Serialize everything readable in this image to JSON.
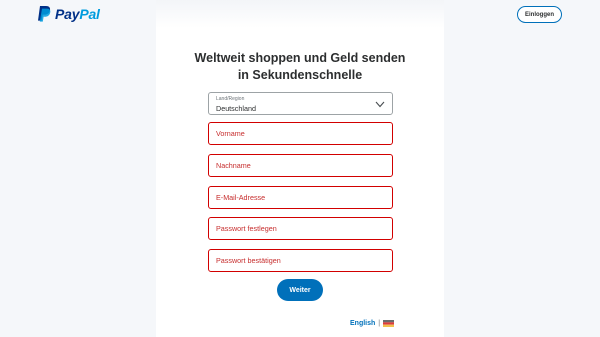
{
  "brand": {
    "logo_pay": "Pay",
    "logo_pal": "Pal",
    "logo_icon": "paypal-p-icon",
    "primary_color": "#003087",
    "secondary_color": "#009cde"
  },
  "header": {
    "login_label": "Einloggen"
  },
  "form": {
    "heading_line1": "Weltweit shoppen und Geld senden",
    "heading_line2": "in Sekundenschnelle",
    "country": {
      "label": "Land/Region",
      "value": "Deutschland",
      "icon": "chevron-down-icon"
    },
    "fields": {
      "first_name": "Vorname",
      "last_name": "Nachname",
      "email": "E-Mail-Adresse",
      "password": "Passwort festlegen",
      "password_confirm": "Passwort bestätigen"
    },
    "error_color": "#d20000",
    "submit_label": "Weiter",
    "accent_color": "#0070ba"
  },
  "footer": {
    "language_link": "English",
    "separator": "|",
    "flag_icon": "germany-flag-icon"
  }
}
